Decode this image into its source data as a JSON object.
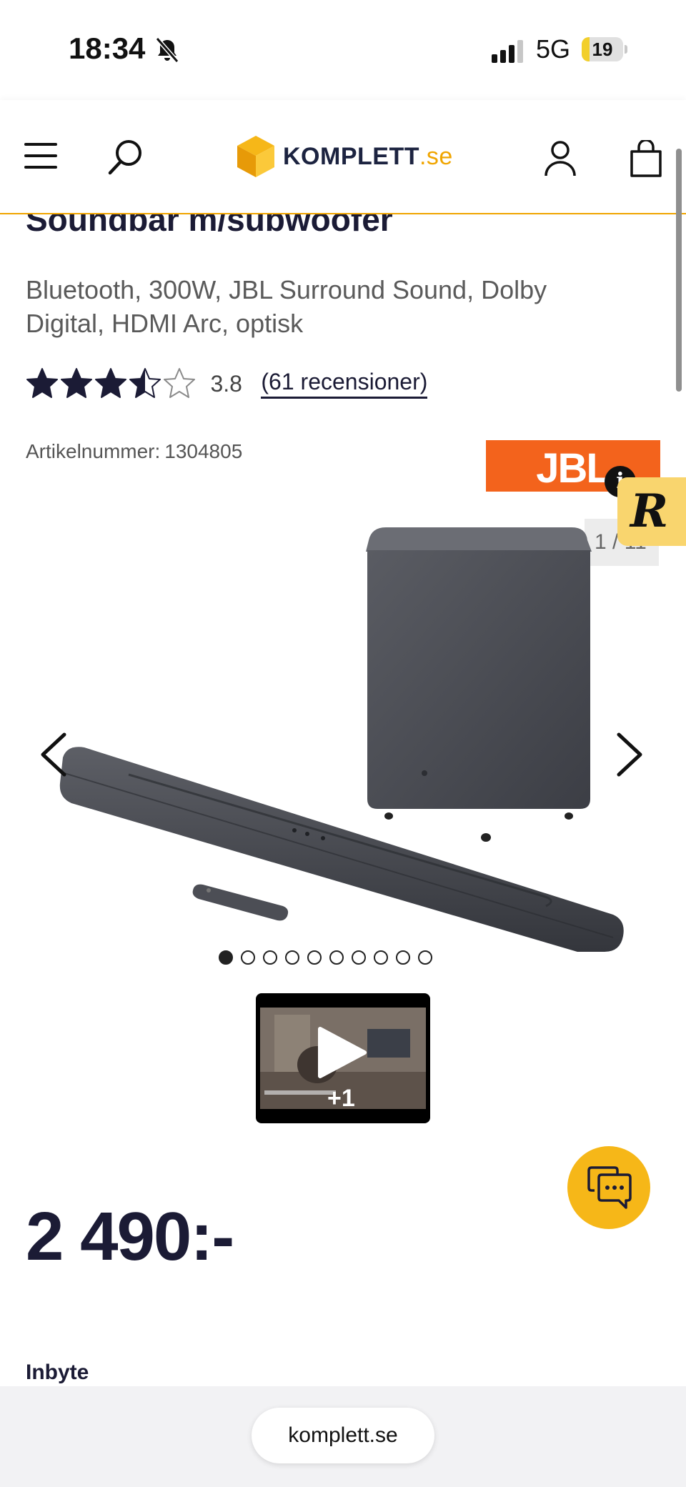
{
  "status_bar": {
    "time": "18:34",
    "network": "5G",
    "battery_level": "19",
    "battery_fraction": 0.19
  },
  "header": {
    "logo_name": "KOMPLETT",
    "logo_tld": ".se",
    "icons": [
      "menu-icon",
      "search-icon",
      "account-icon",
      "cart-icon"
    ]
  },
  "product": {
    "title": "Soundbar m/subwoofer",
    "subtitle": "Bluetooth, 300W, JBL Surround Sound, Dolby Digital, HDMI Arc, optisk",
    "rating": 3.8,
    "rating_label": "3.8",
    "stars_max": 5,
    "reviews_label": "(61 recensioner)",
    "article_label": "Artikelnummer:",
    "article_number": "1304805",
    "brand": "JBL",
    "gallery_counter": "1 / 11",
    "gallery_images": 11,
    "gallery_active": 0,
    "video_more": "+1",
    "price": "2 490:-",
    "trade_in": "Inbyte"
  },
  "widget": {
    "info": "i",
    "letter": "R"
  },
  "browser": {
    "url": "komplett.se"
  },
  "colors": {
    "accent": "#f0a500",
    "chat_button": "#f6b718",
    "brand_logo": "#f3631c",
    "star": "#1b1b35"
  }
}
